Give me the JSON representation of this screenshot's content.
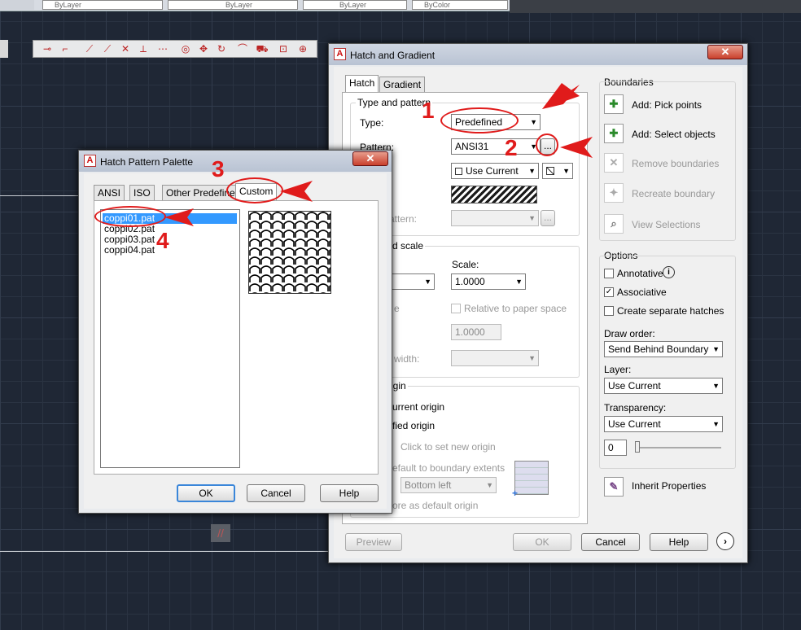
{
  "top_bar": {
    "layer_1": "ByLayer",
    "layer_2": "ByLayer",
    "layer_3": "ByLayer",
    "color": "ByColor"
  },
  "main_dialog": {
    "title": "Hatch and Gradient",
    "tabs": [
      "Hatch",
      "Gradient"
    ],
    "type_pattern": {
      "group": "Type and pattern",
      "type_label": "Type:",
      "type_value": "Predefined",
      "pattern_label": "Pattern:",
      "pattern_value": "ANSI31",
      "browse": "...",
      "color_value": "Use Current",
      "custom_label": "attern:",
      "custom_browse": "..."
    },
    "angle_scale": {
      "group": "d scale",
      "scale_label": "Scale:",
      "scale_value": "1.0000",
      "relative_tail": "e",
      "relative_label": "Relative to paper space",
      "spacing_value": "1.0000",
      "isopen_label": "width:"
    },
    "origin": {
      "group": "igin",
      "current_label": "urrent origin",
      "specified_label": "fied origin",
      "click_label": "Click to set new origin",
      "default_label": "efault to boundary extents",
      "position_value": "Bottom left",
      "store_label": "ore as default origin"
    },
    "boundaries": {
      "group": "Boundaries",
      "add_pick": "Add: Pick points",
      "add_select": "Add: Select objects",
      "remove": "Remove boundaries",
      "recreate": "Recreate boundary",
      "view": "View Selections"
    },
    "options": {
      "group": "Options",
      "annotative": "Annotative",
      "associative": "Associative",
      "separate": "Create separate hatches",
      "draw_order_label": "Draw order:",
      "draw_order_value": "Send Behind Boundary",
      "layer_label": "Layer:",
      "layer_value": "Use Current",
      "transparency_label": "Transparency:",
      "transparency_value": "Use Current",
      "transparency_number": "0"
    },
    "inherit": "Inherit Properties",
    "buttons": {
      "preview": "Preview",
      "ok": "OK",
      "cancel": "Cancel",
      "help": "Help"
    }
  },
  "palette_dialog": {
    "title": "Hatch Pattern Palette",
    "tabs": [
      "ANSI",
      "ISO",
      "Other Predefined",
      "Custom"
    ],
    "files": [
      "coppi01.pat",
      "coppi02.pat",
      "coppi03.pat",
      "coppi04.pat"
    ],
    "buttons": {
      "ok": "OK",
      "cancel": "Cancel",
      "help": "Help"
    }
  },
  "annotations": {
    "step1": "1",
    "step2": "2",
    "step3": "3",
    "step4": "4"
  },
  "colors": {
    "annotation_red": "#e01b1b",
    "selection_blue": "#3399ff",
    "canvas": "#1f2735"
  }
}
